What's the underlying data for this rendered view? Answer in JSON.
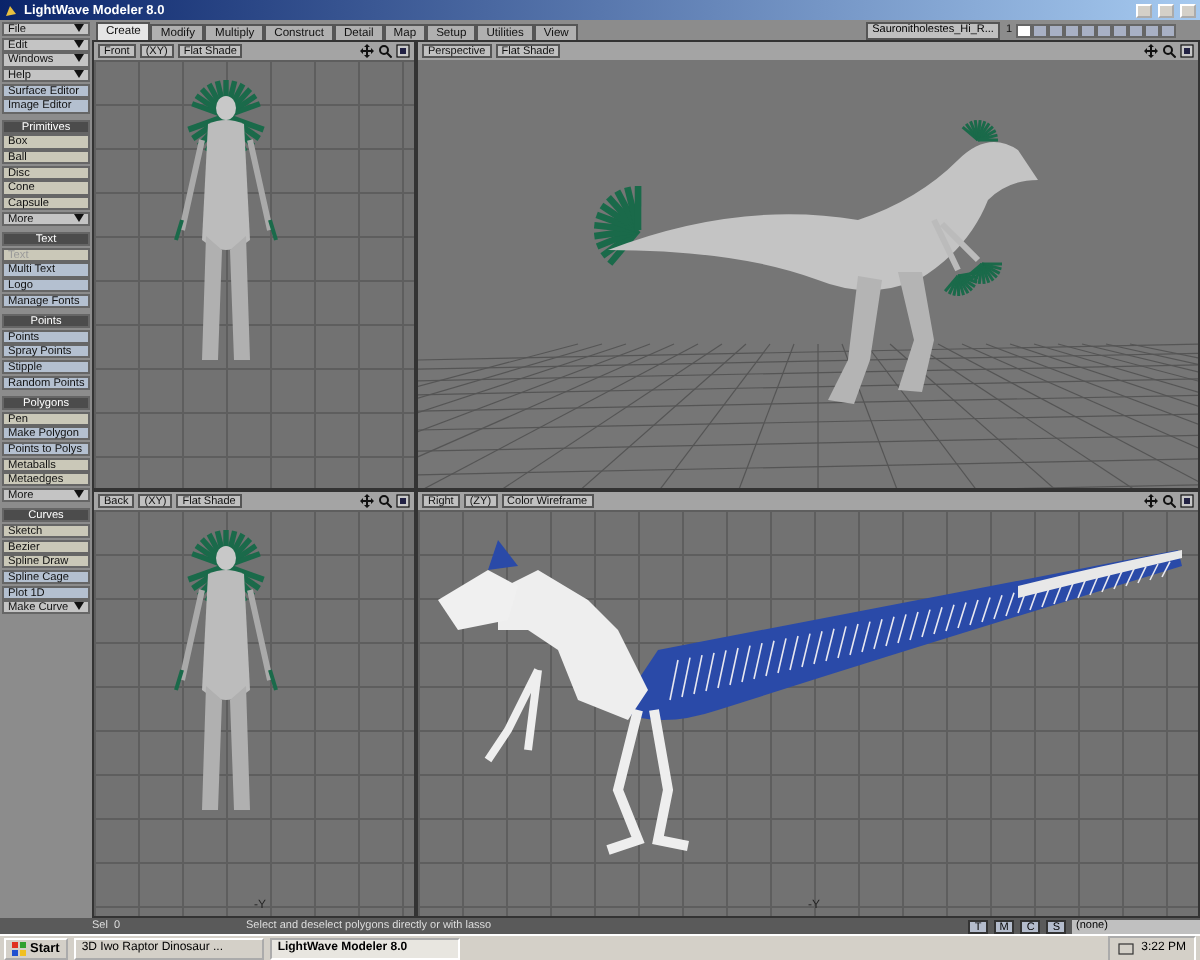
{
  "window": {
    "title": "LightWave Modeler 8.0"
  },
  "sidebar": {
    "items": [
      {
        "kind": "dropdown",
        "label": "File",
        "disabled": false
      },
      {
        "kind": "dropdown",
        "label": "Edit",
        "disabled": false
      },
      {
        "kind": "dropdown",
        "label": "Windows",
        "disabled": false
      },
      {
        "kind": "dropdown",
        "label": "Help",
        "disabled": false
      },
      {
        "kind": "button",
        "label": "Surface Editor",
        "color": "#b4c0d0",
        "disabled": false
      },
      {
        "kind": "button",
        "label": "Image Editor",
        "color": "#b4c0d0",
        "disabled": false
      },
      {
        "kind": "header",
        "label": "Primitives"
      },
      {
        "kind": "button",
        "label": "Box",
        "color": "#cac8b8",
        "disabled": false
      },
      {
        "kind": "button",
        "label": "Ball",
        "color": "#cac8b8",
        "disabled": false
      },
      {
        "kind": "button",
        "label": "Disc",
        "color": "#cac8b8",
        "disabled": false
      },
      {
        "kind": "button",
        "label": "Cone",
        "color": "#cac8b8",
        "disabled": false
      },
      {
        "kind": "button",
        "label": "Capsule",
        "color": "#cac8b8",
        "disabled": false
      },
      {
        "kind": "dropdown",
        "label": "More",
        "disabled": false
      },
      {
        "kind": "header",
        "label": "Text"
      },
      {
        "kind": "button",
        "label": "Text",
        "color": "#cac8b8",
        "disabled": true
      },
      {
        "kind": "button",
        "label": "Multi Text",
        "color": "#b4c0d0",
        "disabled": false
      },
      {
        "kind": "button",
        "label": "Logo",
        "color": "#b4c0d0",
        "disabled": false
      },
      {
        "kind": "button",
        "label": "Manage Fonts",
        "color": "#b4c0d0",
        "disabled": false
      },
      {
        "kind": "header",
        "label": "Points"
      },
      {
        "kind": "button",
        "label": "Points",
        "color": "#b4c0d0",
        "disabled": false
      },
      {
        "kind": "button",
        "label": "Spray Points",
        "color": "#b4c0d0",
        "disabled": false
      },
      {
        "kind": "button",
        "label": "Stipple",
        "color": "#b4c0d0",
        "disabled": false
      },
      {
        "kind": "button",
        "label": "Random Points",
        "color": "#b4c0d0",
        "disabled": false
      },
      {
        "kind": "header",
        "label": "Polygons"
      },
      {
        "kind": "button",
        "label": "Pen",
        "color": "#cac8b8",
        "disabled": false
      },
      {
        "kind": "button",
        "label": "Make Polygon",
        "color": "#b4c0d0",
        "disabled": false
      },
      {
        "kind": "button",
        "label": "Points to Polys",
        "color": "#b4c0d0",
        "disabled": false
      },
      {
        "kind": "button",
        "label": "Metaballs",
        "color": "#cac8b8",
        "disabled": false
      },
      {
        "kind": "button",
        "label": "Metaedges",
        "color": "#cac8b8",
        "disabled": false
      },
      {
        "kind": "dropdown",
        "label": "More",
        "disabled": false
      },
      {
        "kind": "header",
        "label": "Curves"
      },
      {
        "kind": "button",
        "label": "Sketch",
        "color": "#cac8b8",
        "disabled": false
      },
      {
        "kind": "button",
        "label": "Bezier",
        "color": "#cac8b8",
        "disabled": false
      },
      {
        "kind": "button",
        "label": "Spline Draw",
        "color": "#cac8b8",
        "disabled": false
      },
      {
        "kind": "button",
        "label": "Spline Cage",
        "color": "#b4c0d0",
        "disabled": false
      },
      {
        "kind": "button",
        "label": "Plot 1D",
        "color": "#b4c0d0",
        "disabled": false
      },
      {
        "kind": "dropdown",
        "label": "Make Curve",
        "disabled": false
      }
    ]
  },
  "tabs": [
    {
      "label": "Create",
      "selected": true
    },
    {
      "label": "Modify",
      "selected": false
    },
    {
      "label": "Multiply",
      "selected": false
    },
    {
      "label": "Construct",
      "selected": false
    },
    {
      "label": "Detail",
      "selected": false
    },
    {
      "label": "Map",
      "selected": false
    },
    {
      "label": "Setup",
      "selected": false
    },
    {
      "label": "Utilities",
      "selected": false
    },
    {
      "label": "View",
      "selected": false
    }
  ],
  "toolbar": {
    "object": "Sauronitholestes_Hi_R...",
    "layer": "1",
    "layers": [
      {
        "selected": true
      },
      {
        "selected": false
      },
      {
        "selected": false
      },
      {
        "selected": false
      },
      {
        "selected": false
      },
      {
        "selected": false
      },
      {
        "selected": false
      },
      {
        "selected": false
      },
      {
        "selected": false
      },
      {
        "selected": false
      }
    ]
  },
  "viewports": [
    {
      "kind": "front",
      "view": "Front",
      "axes": "(XY)",
      "shading": "Flat Shade"
    },
    {
      "kind": "perspective",
      "view": "Perspective",
      "shading": "Flat Shade"
    },
    {
      "kind": "back",
      "view": "Back",
      "axes": "(XY)",
      "shading": "Flat Shade",
      "axis_label": "-Y"
    },
    {
      "kind": "side",
      "view": "Right",
      "axes": "(ZY)",
      "shading": "Color Wireframe",
      "axis_label": "-Y"
    }
  ],
  "status_bar": {
    "sel_label": "Sel",
    "sel_count": "0",
    "message": "Select and deselect polygons directly or with lasso",
    "modes": [
      "T",
      "M",
      "C",
      "S"
    ],
    "dropdown": "(none)"
  },
  "taskbar": {
    "start": "Start",
    "tasks": [
      {
        "label": "3D Iwo Raptor Dinosaur ...",
        "selected": false
      },
      {
        "label": "LightWave Modeler 8.0",
        "selected": true
      }
    ],
    "clock": "3:22 PM"
  }
}
